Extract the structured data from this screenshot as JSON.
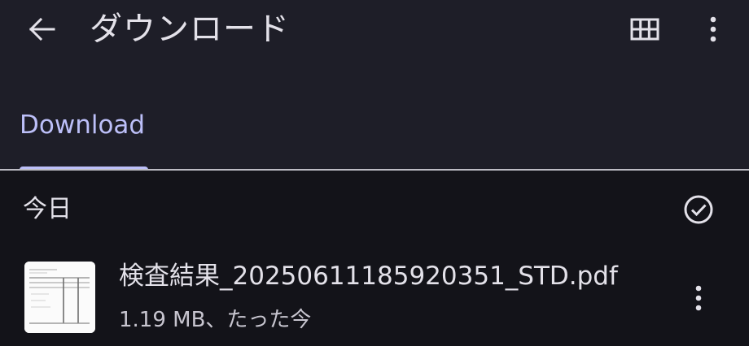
{
  "toolbar": {
    "title": "ダウンロード",
    "back_icon": "arrow-left-icon",
    "grid_icon": "grid-view-icon",
    "more_icon": "more-vert-icon"
  },
  "tabs": [
    {
      "label": "Download",
      "selected": true
    }
  ],
  "section": {
    "title": "今日",
    "select_icon": "check-circle-icon"
  },
  "files": [
    {
      "name": "検査結果_20250611185920351_STD.pdf",
      "meta": "1.19 MB、たった今",
      "thumbnail": "pdf-document-thumbnail",
      "more_icon": "more-vert-icon"
    }
  ],
  "colors": {
    "background": "#131319",
    "toolbar_background": "#1e1e28",
    "accent": "#bcbff8",
    "text_primary": "#e3e1e9",
    "text_secondary": "#c7c5cf"
  }
}
